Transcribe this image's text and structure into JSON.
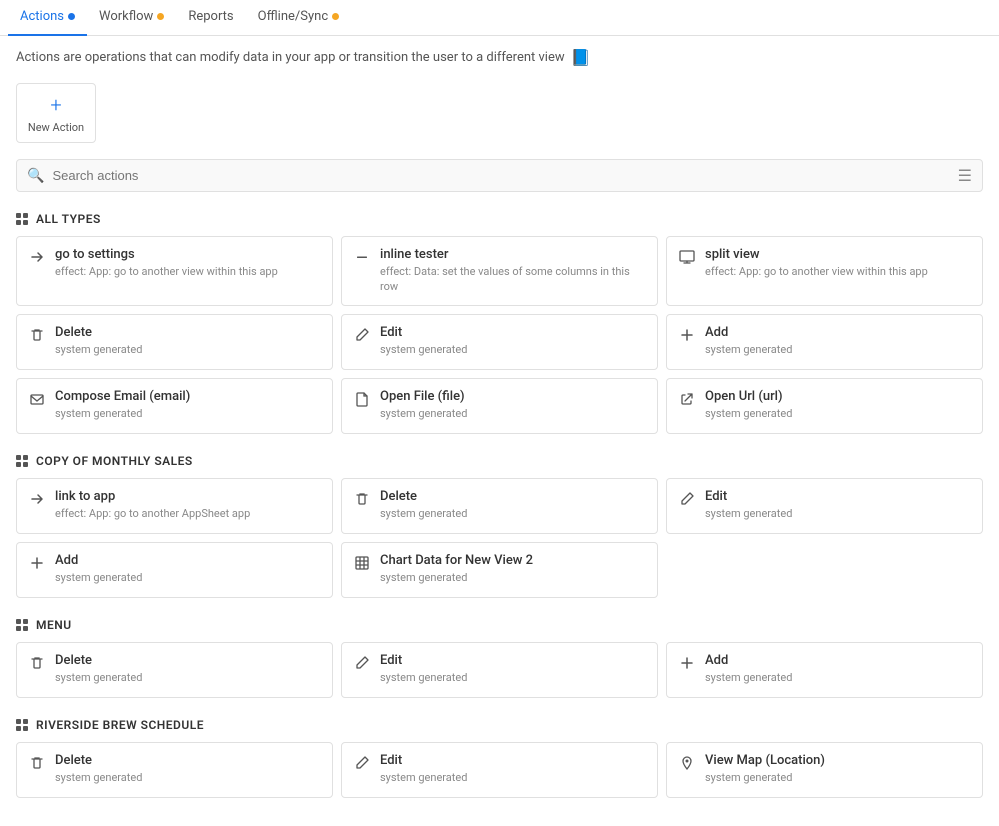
{
  "tabs": [
    {
      "id": "actions",
      "label": "Actions",
      "active": true,
      "dot": "blue"
    },
    {
      "id": "workflow",
      "label": "Workflow",
      "active": false,
      "dot": "orange"
    },
    {
      "id": "reports",
      "label": "Reports",
      "active": false,
      "dot": null
    },
    {
      "id": "offline-sync",
      "label": "Offline/Sync",
      "active": false,
      "dot": "orange"
    }
  ],
  "description": "Actions are operations that can modify data in your app or transition the user to a different view",
  "new_action_label": "New Action",
  "search_placeholder": "Search actions",
  "sections": [
    {
      "id": "all-types",
      "label": "ALL TYPES",
      "actions": [
        {
          "id": "go-to-settings",
          "title": "go to settings",
          "subtitle": "effect: App: go to another view within this app",
          "icon": "arrow"
        },
        {
          "id": "inline-tester",
          "title": "inline tester",
          "subtitle": "effect: Data: set the values of some columns in this row",
          "icon": "minus"
        },
        {
          "id": "split-view",
          "title": "split view",
          "subtitle": "effect: App: go to another view within this app",
          "icon": "monitor"
        },
        {
          "id": "delete-1",
          "title": "Delete",
          "subtitle": "system generated",
          "icon": "trash"
        },
        {
          "id": "edit-1",
          "title": "Edit",
          "subtitle": "system generated",
          "icon": "pencil"
        },
        {
          "id": "add-1",
          "title": "Add",
          "subtitle": "system generated",
          "icon": "plus"
        },
        {
          "id": "compose-email",
          "title": "Compose Email (email)",
          "subtitle": "system generated",
          "icon": "envelope"
        },
        {
          "id": "open-file",
          "title": "Open File (file)",
          "subtitle": "system generated",
          "icon": "file"
        },
        {
          "id": "open-url",
          "title": "Open Url (url)",
          "subtitle": "system generated",
          "icon": "external-link"
        }
      ]
    },
    {
      "id": "copy-monthly-sales",
      "label": "Copy of monthly sales",
      "actions": [
        {
          "id": "link-to-app",
          "title": "link to app",
          "subtitle": "effect: App: go to another AppSheet app",
          "icon": "arrow"
        },
        {
          "id": "delete-2",
          "title": "Delete",
          "subtitle": "system generated",
          "icon": "trash"
        },
        {
          "id": "edit-2",
          "title": "Edit",
          "subtitle": "system generated",
          "icon": "pencil"
        },
        {
          "id": "add-2",
          "title": "Add",
          "subtitle": "system generated",
          "icon": "plus"
        },
        {
          "id": "chart-data",
          "title": "Chart Data for New View 2",
          "subtitle": "system generated",
          "icon": "table"
        }
      ]
    },
    {
      "id": "menu",
      "label": "Menu",
      "actions": [
        {
          "id": "delete-3",
          "title": "Delete",
          "subtitle": "system generated",
          "icon": "trash"
        },
        {
          "id": "edit-3",
          "title": "Edit",
          "subtitle": "system generated",
          "icon": "pencil"
        },
        {
          "id": "add-3",
          "title": "Add",
          "subtitle": "system generated",
          "icon": "plus"
        }
      ]
    },
    {
      "id": "riverside-brew",
      "label": "Riverside Brew Schedule",
      "actions": [
        {
          "id": "delete-4",
          "title": "Delete",
          "subtitle": "system generated",
          "icon": "trash"
        },
        {
          "id": "edit-4",
          "title": "Edit",
          "subtitle": "system generated",
          "icon": "pencil"
        },
        {
          "id": "view-map",
          "title": "View Map (Location)",
          "subtitle": "system generated",
          "icon": "map-pin"
        }
      ]
    }
  ],
  "icons": {
    "arrow": "➤",
    "minus": "—",
    "monitor": "🖥",
    "trash": "🗑",
    "pencil": "✎",
    "plus": "+",
    "envelope": "✉",
    "file": "📄",
    "external-link": "↗",
    "table": "⊞",
    "map-pin": "📍"
  }
}
